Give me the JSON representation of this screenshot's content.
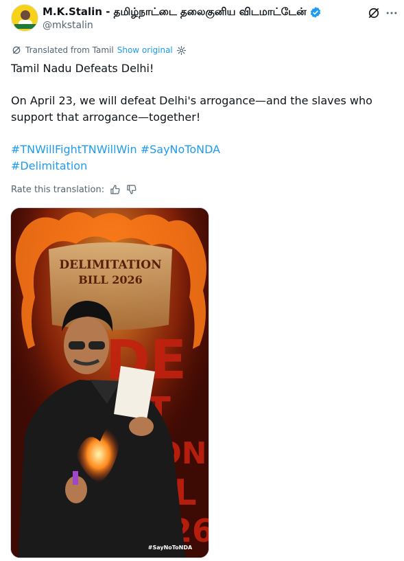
{
  "author": {
    "name": "M.K.Stalin - தமிழ்நாட்டை தலைகுனிய விடமாட்டேன்",
    "handle": "@mkstalin",
    "verified_color": "#1d9bf0"
  },
  "translation": {
    "label": "Translated from Tamil",
    "show_original": "Show original",
    "rate_label": "Rate this translation:"
  },
  "post": {
    "line1": "Tamil Nadu Defeats Delhi!",
    "line2": "On April 23, we will defeat Delhi's arrogance—and the slaves who",
    "line3": "support that arrogance—together!",
    "hashtag1": "#TNWillFightTNWillWin",
    "hashtag2": "#SayNoToNDA",
    "hashtag3": "#Delimitation"
  },
  "image": {
    "doc_line1": "DELIMITATION",
    "doc_line2": "BILL 2026",
    "big_line1": "DE",
    "big_line2": "IT",
    "big_line3": "TION",
    "big_line4": "ILL",
    "big_line5": "026",
    "tag": "#SayNoToNDA"
  },
  "icons": [
    "grok-icon",
    "more-icon",
    "translate-icon",
    "gear-icon",
    "thumbs-up-icon",
    "thumbs-down-icon",
    "verified-badge-icon"
  ],
  "colors": {
    "accent": "#1d9bf0",
    "text": "#0f1419",
    "muted": "#536471"
  }
}
